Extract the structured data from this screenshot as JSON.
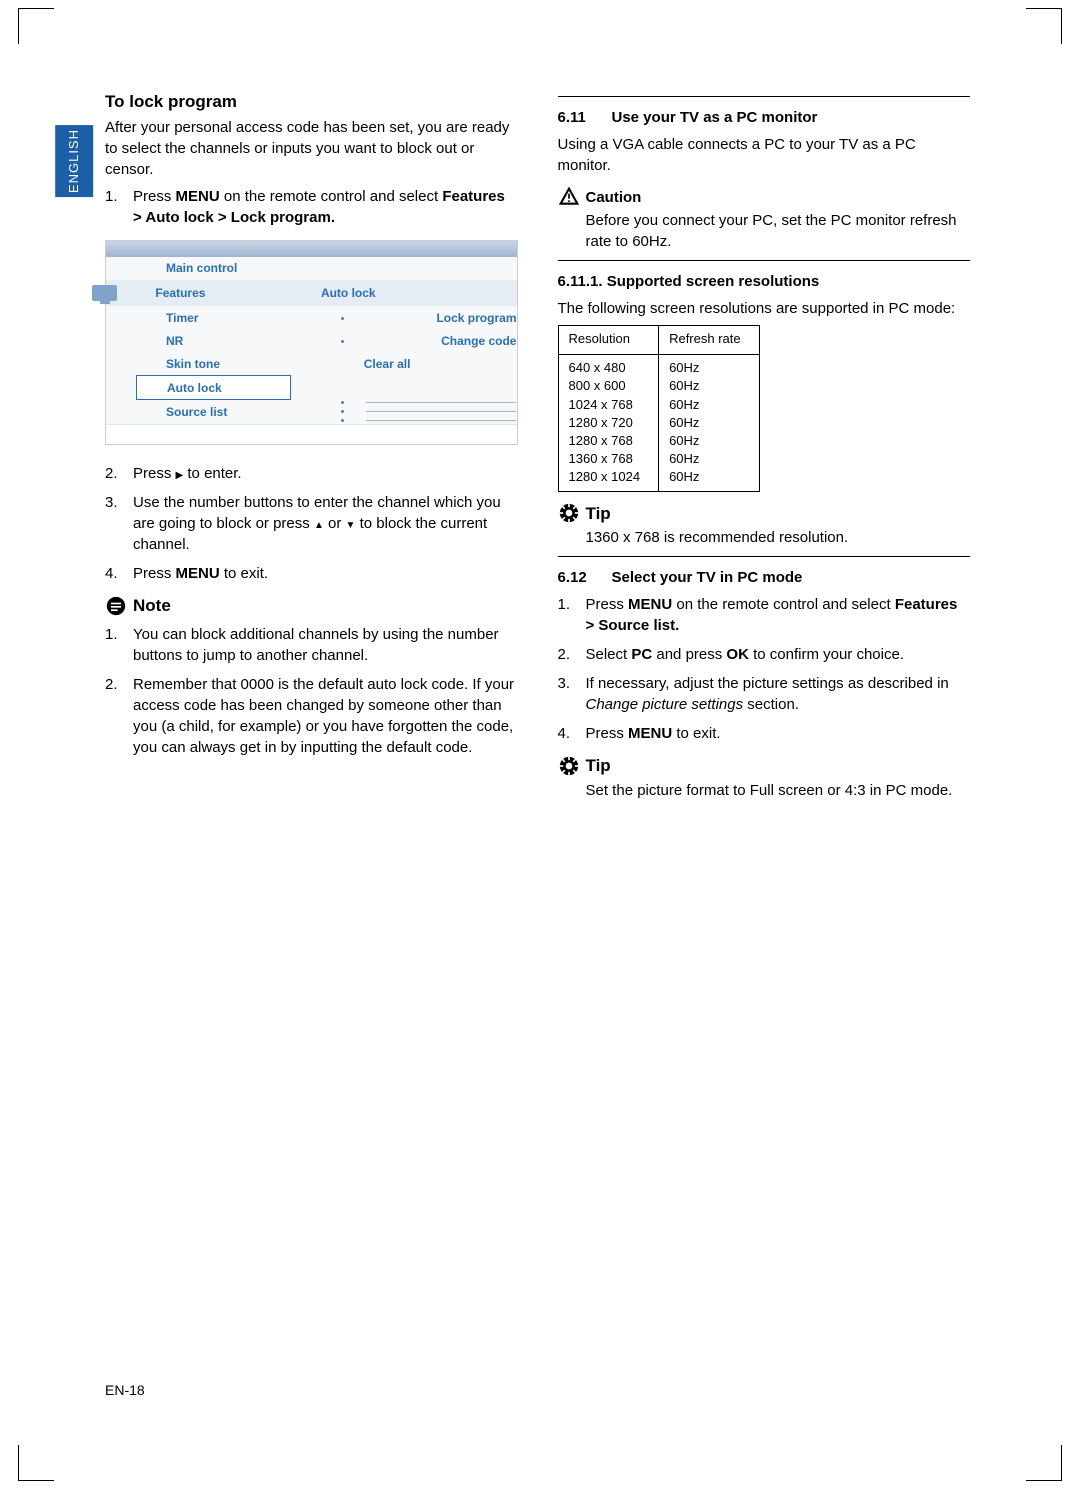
{
  "langtab": "ENGLISH",
  "left": {
    "heading": "To lock program",
    "intro": "After your personal access code has been set, you are ready to select the channels or inputs you want to block out or censor.",
    "step1_pre": "Press ",
    "step1_menu": "MENU",
    "step1_post": " on the remote control and select ",
    "step1_path": "Features > Auto lock > Lock program.",
    "menu": {
      "main": "Main control",
      "features": "Features",
      "autolock": "Auto lock",
      "items": [
        "Timer",
        "NR",
        "Skin tone",
        "Auto lock",
        "Source list"
      ],
      "dim": [
        "Lock program",
        "Change code",
        "Clear all"
      ]
    },
    "step2_pre": "Press ",
    "step2_post": " to enter.",
    "step3_a": "Use the number buttons to enter the channel which you are going to block or press ",
    "step3_b": " or ",
    "step3_c": " to block the current channel.",
    "step4_pre": "Press ",
    "step4_menu": "MENU",
    "step4_post": " to exit.",
    "note_label": "Note",
    "note1": "You can block additional channels by using the number buttons to jump to another channel.",
    "note2": "Remember that 0000 is the default auto lock code.  If your access code has been changed by someone other than you (a child, for example) or you have forgotten the code, you can always get in by inputting the default code."
  },
  "right": {
    "s611_num": "6.11",
    "s611_title": "Use your TV as a PC monitor",
    "s611_body": "Using a VGA cable connects a PC to your TV as a PC monitor.",
    "caution_label": "Caution",
    "caution_body": "Before you connect your PC, set the PC monitor refresh rate to 60Hz.",
    "s6111_title": "6.11.1.  Supported screen resolutions",
    "s6111_body": "The following screen resolutions are supported in PC mode:",
    "table_head_res": "Resolution",
    "table_head_rate": "Refresh rate",
    "table_rows": [
      {
        "res": "640 x 480",
        "rate": "60Hz"
      },
      {
        "res": "800 x 600",
        "rate": "60Hz"
      },
      {
        "res": "1024 x 768",
        "rate": "60Hz"
      },
      {
        "res": "1280 x 720",
        "rate": "60Hz"
      },
      {
        "res": "1280 x 768",
        "rate": "60Hz"
      },
      {
        "res": "1360 x 768",
        "rate": "60Hz"
      },
      {
        "res": "1280 x 1024",
        "rate": "60Hz"
      }
    ],
    "tip_label": "Tip",
    "tip1_body": "1360 x 768 is recommended resolution.",
    "s612_num": "6.12",
    "s612_title": "Select your TV in PC mode",
    "s612_step1_pre": "Press ",
    "s612_step1_menu": "MENU",
    "s612_step1_post": " on the remote control and select ",
    "s612_step1_path": "Features > Source list.",
    "s612_step2_a": "Select ",
    "s612_step2_pc": "PC",
    "s612_step2_b": " and press ",
    "s612_step2_ok": "OK",
    "s612_step2_c": " to confirm your choice.",
    "s612_step3_a": "If necessary, adjust the picture settings as described in ",
    "s612_step3_i": "Change picture settings",
    "s612_step3_b": " section.",
    "s612_step4_pre": "Press ",
    "s612_step4_menu": "MENU",
    "s612_step4_post": " to exit.",
    "tip2_body": "Set the picture format to Full screen or 4:3 in PC mode."
  },
  "pagenum": "EN-18"
}
